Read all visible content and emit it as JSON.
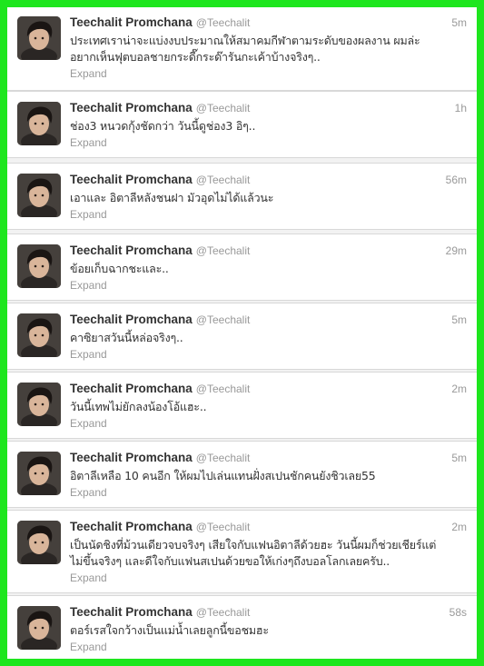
{
  "tweets": [
    {
      "name": "Teechalit Promchana",
      "handle": "@Teechalit",
      "time": "5m",
      "text": "ประเทศเราน่าจะแบ่งงบประมาณให้สมาคมกีฬาตามระดับของผลงาน ผมล่ะ\nอยากเห็นฟุตบอลชายกระดี๊กระด๊ารันกะเค้าบ้างจริงๆ..",
      "expand": "Expand"
    },
    {
      "name": "Teechalit Promchana",
      "handle": "@Teechalit",
      "time": "1h",
      "text": "ช่อง3 หนวดกุ้งชัดกว่า วันนี้ดูช่อง3 อิๆ..",
      "expand": "Expand"
    },
    {
      "name": "Teechalit Promchana",
      "handle": "@Teechalit",
      "time": "56m",
      "text": "เอาและ อิตาลีหลังชนฝา มัวอุดไม่ได้แล้วนะ",
      "expand": "Expand"
    },
    {
      "name": "Teechalit Promchana",
      "handle": "@Teechalit",
      "time": "29m",
      "text": "ข้อยเก็บฉากชะและ..",
      "expand": "Expand"
    },
    {
      "name": "Teechalit Promchana",
      "handle": "@Teechalit",
      "time": "5m",
      "text": "คาซิยาสวันนี้หล่อจริงๆ..",
      "expand": "Expand"
    },
    {
      "name": "Teechalit Promchana",
      "handle": "@Teechalit",
      "time": "2m",
      "text": "วันนี้เทพไม่ยักลงน้องโอ้แฮะ..",
      "expand": "Expand"
    },
    {
      "name": "Teechalit Promchana",
      "handle": "@Teechalit",
      "time": "5m",
      "text": "อิตาลีเหลือ 10 คนอีก ให้ผมไปเล่นแทนฝั่งสเปนชักคนยังชิวเลย55",
      "expand": "Expand"
    },
    {
      "name": "Teechalit Promchana",
      "handle": "@Teechalit",
      "time": "2m",
      "text": "เป็นนัดชิงที่ม้วนเดียวจบจริงๆ เสียใจกับแฟนอิตาลีด้วยฮะ วันนี้ผมก็ช่วยเชียร์แต่\nไม่ขึ้นจริงๆ และดีใจกับแฟนสเปนด้วยขอให้เก่งๆถึงบอลโลกเลยครับ..",
      "expand": "Expand"
    },
    {
      "name": "Teechalit Promchana",
      "handle": "@Teechalit",
      "time": "58s",
      "text": "ตอร์เรสใจกว้างเป็นแม่น้ำเลยลูกนี้ขอชมฮะ",
      "expand": "Expand"
    }
  ]
}
